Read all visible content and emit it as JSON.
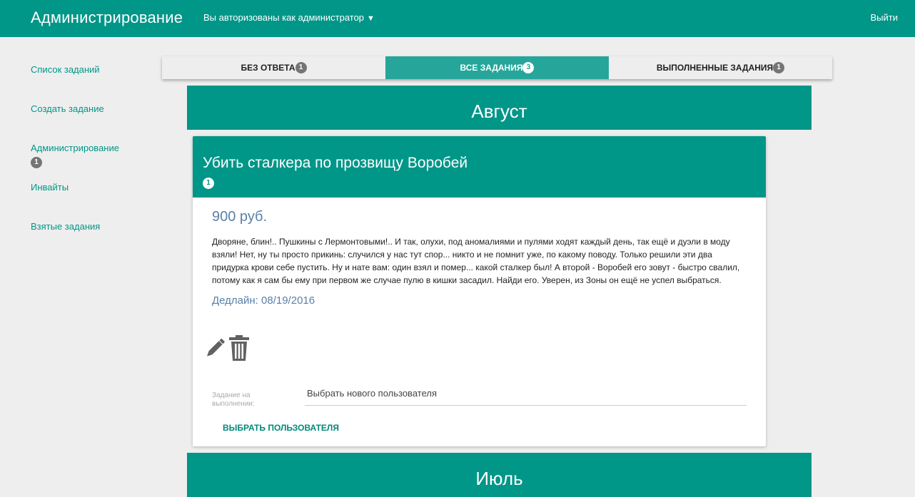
{
  "header": {
    "title": "Администрирование",
    "auth_text": "Вы авторизованы как администратор",
    "caret": "▼",
    "logout": "Выйти"
  },
  "sidebar": {
    "items": [
      {
        "label": "Список заданий"
      },
      {
        "label": "Создать задание"
      },
      {
        "label": "Администрирование",
        "badge": "1"
      },
      {
        "label": "Инвайты"
      },
      {
        "label": "Взятые задания"
      }
    ]
  },
  "tabs": [
    {
      "label": "БЕЗ ОТВЕТА",
      "count": "1",
      "active": false
    },
    {
      "label": "ВСЕ ЗАДАНИЯ",
      "count": "3",
      "active": true
    },
    {
      "label": "ВЫПОЛНЕННЫЕ ЗАДАНИЯ",
      "count": "1",
      "active": false
    }
  ],
  "months": {
    "first": "Август",
    "second": "Июль"
  },
  "task": {
    "title": "Убить сталкера по прозвищу Воробей",
    "badge": "1",
    "price": "900 руб.",
    "description": "Дворяне, блин!.. Пушкины с Лермонтовыми!.. И так, олухи, под аномалиями и пулями ходят каждый день, так ещё и дуэли в моду взяли! Нет, ну ты просто прикинь: случился у нас тут спор... никто и не помнит уже, по какому поводу. Только решили эти два придурка крови себе пустить. Ну и нате вам: один взял и помер... какой сталкер был! А второй - Воробей его зовут - быстро свалил, потому как я сам бы ему при первом же случае пулю в кишки засадил. Найди его. Уверен, из Зоны он ещё не успел выбраться.",
    "deadline": "Дедлайн: 08/19/2016",
    "assign_label": "Задание на выполнении:",
    "assign_placeholder": "Выбрать нового пользователя",
    "pick_button": "ВЫБРАТЬ ПОЛЬЗОВАТЕЛЯ"
  },
  "icons": {
    "edit": "pencil-icon",
    "delete": "trash-icon"
  },
  "colors": {
    "primary": "#009688",
    "tab_active": "#26a69a",
    "price_text": "#5b80a8",
    "badge_gray": "#757575"
  }
}
